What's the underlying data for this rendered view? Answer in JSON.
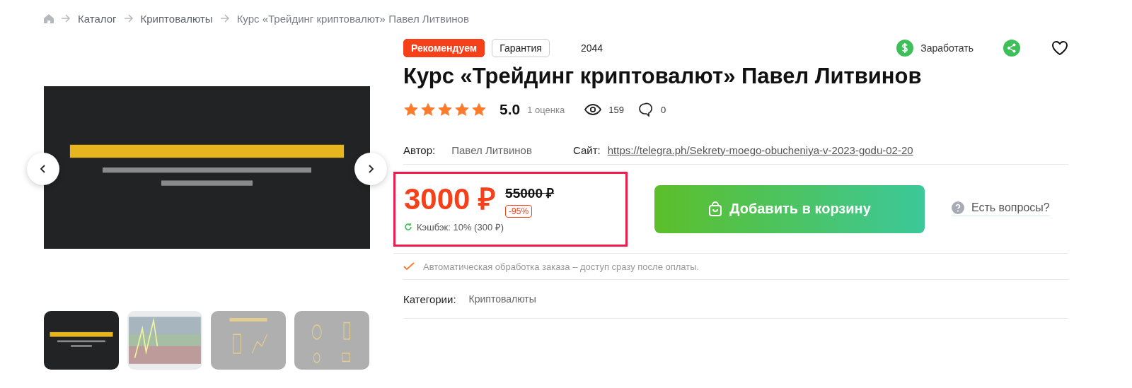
{
  "breadcrumbs": [
    {
      "label": "Каталог"
    },
    {
      "label": "Криптовалюты"
    },
    {
      "label": "Курс «Трейдинг криптовалют» Павел Литвинов"
    }
  ],
  "gallery": {
    "main": {
      "kind": "picture"
    },
    "thumbnails": [
      {
        "kind": "picture",
        "selected": true
      },
      {
        "kind": "picture",
        "selected": false
      },
      {
        "kind": "picture",
        "selected": false
      },
      {
        "kind": "picture",
        "selected": false
      }
    ]
  },
  "badges": [
    {
      "label": "Рекомендуем",
      "kind": "accent"
    },
    {
      "label": "Гарантия",
      "kind": "outline"
    }
  ],
  "product_code": "2044",
  "actions": {
    "earn": "Заработать"
  },
  "title": "Курс «Трейдинг криптовалют» Павел Литвинов",
  "rating": {
    "stars": 5,
    "value": "5.0",
    "count": "1 оценка"
  },
  "views": "159",
  "comments": "0",
  "author": {
    "label": "Автор:",
    "value": "Павел Литвинов"
  },
  "site": {
    "label": "Сайт:",
    "value": "https://telegra.ph/Sekrety-moego-obucheniya-v-2023-godu-02-20"
  },
  "price": {
    "current": "3000 ₽",
    "old": "55000 ₽",
    "discount": "-95%",
    "cashback": "Кэшбэк: 10% (300 ₽)"
  },
  "cart_button": "Добавить в корзину",
  "questions": "Есть вопросы?",
  "notice": "Автоматическая обработка заказа – доступ сразу после оплаты.",
  "categories": {
    "label": "Категории:",
    "value": "Криптовалюты"
  }
}
